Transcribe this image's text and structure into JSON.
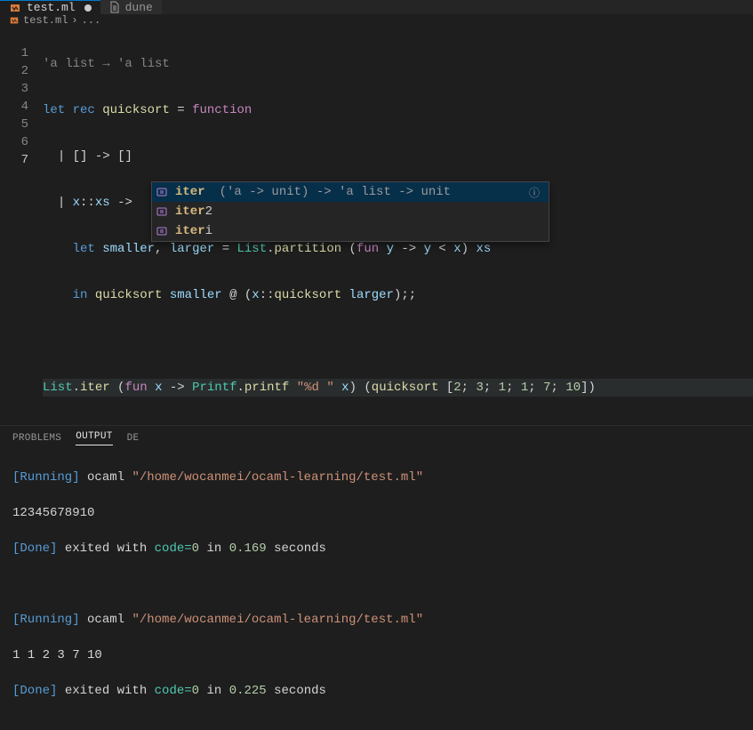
{
  "tabs": {
    "active": {
      "label": "test.ml"
    },
    "inactive": {
      "label": "dune"
    }
  },
  "breadcrumb": {
    "file": "test.ml",
    "sep": "›",
    "more": "..."
  },
  "editor": {
    "hint": "'a list → 'a list",
    "gutter": [
      "1",
      "2",
      "3",
      "4",
      "5",
      "6",
      "7"
    ],
    "tokens": {
      "let": "let",
      "rec": "rec",
      "quicksort": "quicksort",
      "eq": "=",
      "function": "function",
      "pipe": "|",
      "lbr": "[]",
      "arrow": "->",
      "x": "x",
      "cons": "::",
      "xs": "xs",
      "let2": "let",
      "smaller": "smaller",
      "comma": ",",
      "larger": "larger",
      "List": "List",
      "dot": ".",
      "partition": "partition",
      "lp": "(",
      "rp": ")",
      "fun": "fun",
      "y": "y",
      "lt": "<",
      "in": "in",
      "at": "@",
      "dsc": ";;",
      "iter": "iter",
      "Printf": "Printf",
      "printf": "printf",
      "fmt": "\"%d \"",
      "lbrk": "[",
      "rbrk": "]",
      "sc": ";",
      "n2": "2",
      "n3": "3",
      "n1a": "1",
      "n1b": "1",
      "n7": "7",
      "n10": "10"
    }
  },
  "completion": {
    "items": [
      {
        "match": "iter",
        "rest": "",
        "sig": "('a -> unit) -> 'a list -> unit",
        "selected": true
      },
      {
        "match": "iter",
        "rest": "2",
        "sig": "",
        "selected": false
      },
      {
        "match": "iter",
        "rest": "i",
        "sig": "",
        "selected": false
      }
    ]
  },
  "panel": {
    "tabs": {
      "problems": "PROBLEMS",
      "output": "OUTPUT",
      "debug": "DE"
    },
    "runs": [
      {
        "running_label": "[Running]",
        "running_cmd": "ocaml \"/home/wocanmei/ocaml-learning/test.ml\"",
        "output": "12345678910",
        "done_label": "[Done]",
        "done_prefix": "exited with",
        "code_label": "code=",
        "code_value": "0",
        "in_label": "in",
        "time_value": "0.169",
        "seconds_label": "seconds"
      },
      {
        "running_label": "[Running]",
        "running_cmd": "ocaml \"/home/wocanmei/ocaml-learning/test.ml\"",
        "output": "1 1 2 3 7 10",
        "done_label": "[Done]",
        "done_prefix": "exited with",
        "code_label": "code=",
        "code_value": "0",
        "in_label": "in",
        "time_value": "0.225",
        "seconds_label": "seconds"
      }
    ]
  }
}
